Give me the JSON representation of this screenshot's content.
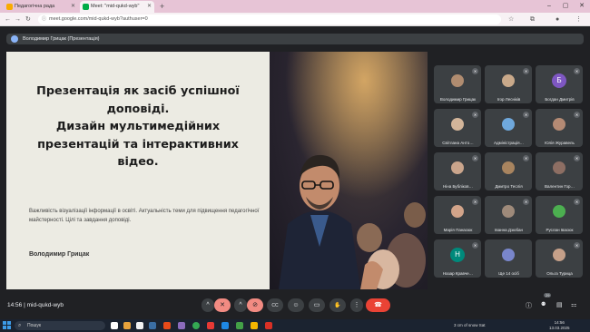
{
  "browser": {
    "tabs": [
      {
        "label": "Педагогічна рада",
        "favicon_color": "#f9ab00"
      },
      {
        "label": "Meet: \"mid-qukd-wyb\"",
        "favicon_color": "#00ac47"
      }
    ],
    "new_tab_glyph": "+",
    "url": "meet.google.com/mid-qukd-wyb?authuser=0",
    "window_controls": [
      "–",
      "▢",
      "✕"
    ]
  },
  "meet": {
    "presenter_label": "Володимир Грицак (Презентація)",
    "slide": {
      "title": "Презентація як засіб успішної\nдоповіді.\nДизайн мультимедійних\nпрезентацій та інтерактивних\nвідео.",
      "subtitle": "Важливість візуалізації інформації в освіті. Актуальність теми для підвищення педагогічної майстерності. Цілі та завдання доповіді.",
      "author": "Володимир Грицак"
    },
    "participants": [
      {
        "name": "Володимир Грицак",
        "kind": "face",
        "color": "#b08c70"
      },
      {
        "name": "Ігор Лесніків",
        "kind": "face",
        "color": "#c9a98a"
      },
      {
        "name": "Богдан Дмитрів",
        "kind": "letter",
        "letter": "Б",
        "color": "#7e57c2"
      },
      {
        "name": "Світлана Анто…",
        "kind": "face",
        "color": "#d3b59a"
      },
      {
        "name": "Адміністрація…",
        "kind": "face",
        "color": "#6fa8dc"
      },
      {
        "name": "Юлія Журавель",
        "kind": "face",
        "color": "#b48a74"
      },
      {
        "name": "Ніна Бубліков…",
        "kind": "face",
        "color": "#caa58c"
      },
      {
        "name": "Дмитро Теслія",
        "kind": "face",
        "color": "#a8845f"
      },
      {
        "name": "Валентин Гор…",
        "kind": "face",
        "color": "#8d6e63"
      },
      {
        "name": "Марія Панасюк",
        "kind": "face",
        "color": "#d2a48a"
      },
      {
        "name": "Іванна Дзюбан",
        "kind": "face",
        "color": "#9e8a7a"
      },
      {
        "name": "Руслан Івасюк",
        "kind": "face",
        "color": "#4caf50"
      },
      {
        "name": "Назар Кравче…",
        "kind": "letter",
        "letter": "Н",
        "color": "#00897b"
      },
      {
        "name": "Ще 14 осіб",
        "kind": "face",
        "color": "#7986cb"
      },
      {
        "name": "Ольга Турица",
        "kind": "face",
        "color": "#c5a089"
      }
    ],
    "time": "14:56",
    "meeting_code": "mid-qukd-wyb",
    "participants_count": "29",
    "controls": {
      "chevron": "^",
      "mic_off": "🎤",
      "cam_off": "📷",
      "captions": "CC",
      "emoji": "☺",
      "present": "▭",
      "raise_hand": "✋",
      "more": "⋮",
      "leave": "☎",
      "info": "ⓘ",
      "people": "👥",
      "chat": "💬",
      "activities": "⚏",
      "lock": "🔒"
    }
  },
  "taskbar": {
    "search_label": "Пошук",
    "tray_text": "3 cm of snow Sat",
    "clock_time": "14:56",
    "clock_date": "13.03.2025",
    "start_color": "#3c9be8"
  }
}
